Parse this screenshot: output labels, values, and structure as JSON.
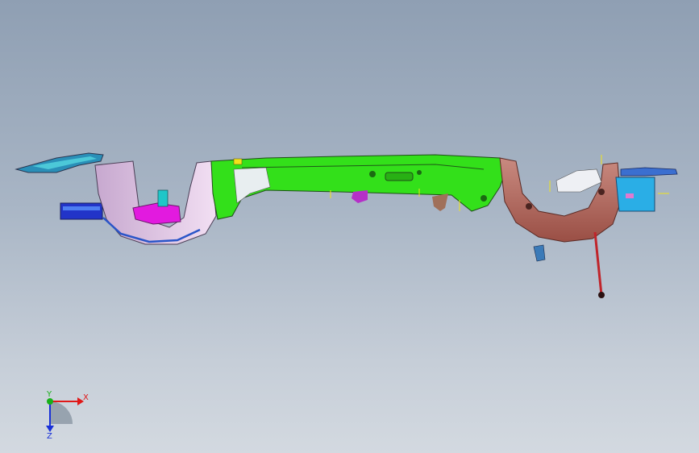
{
  "viewport": {
    "background_top": "#8f9fb3",
    "background_bottom": "#d3d9e0"
  },
  "model": {
    "part_colors": {
      "main_rail": "#33e01a",
      "left_wheelhouse": "#e9c9ea",
      "right_wheelhouse": "#b96e63",
      "left_inner_bracket": "#e21adf",
      "left_blue_bracket": "#2234c8",
      "right_cyan_bracket": "#2aaee6",
      "strut_rod": "#c0242a",
      "cyan_panels": "#1fc6c8",
      "outline": "#3a3a44"
    }
  },
  "triad": {
    "x_label": "X",
    "y_label": "Y",
    "z_label": "Z",
    "x_color": "#e01818",
    "y_color": "#18b018",
    "z_color": "#1830d8"
  }
}
